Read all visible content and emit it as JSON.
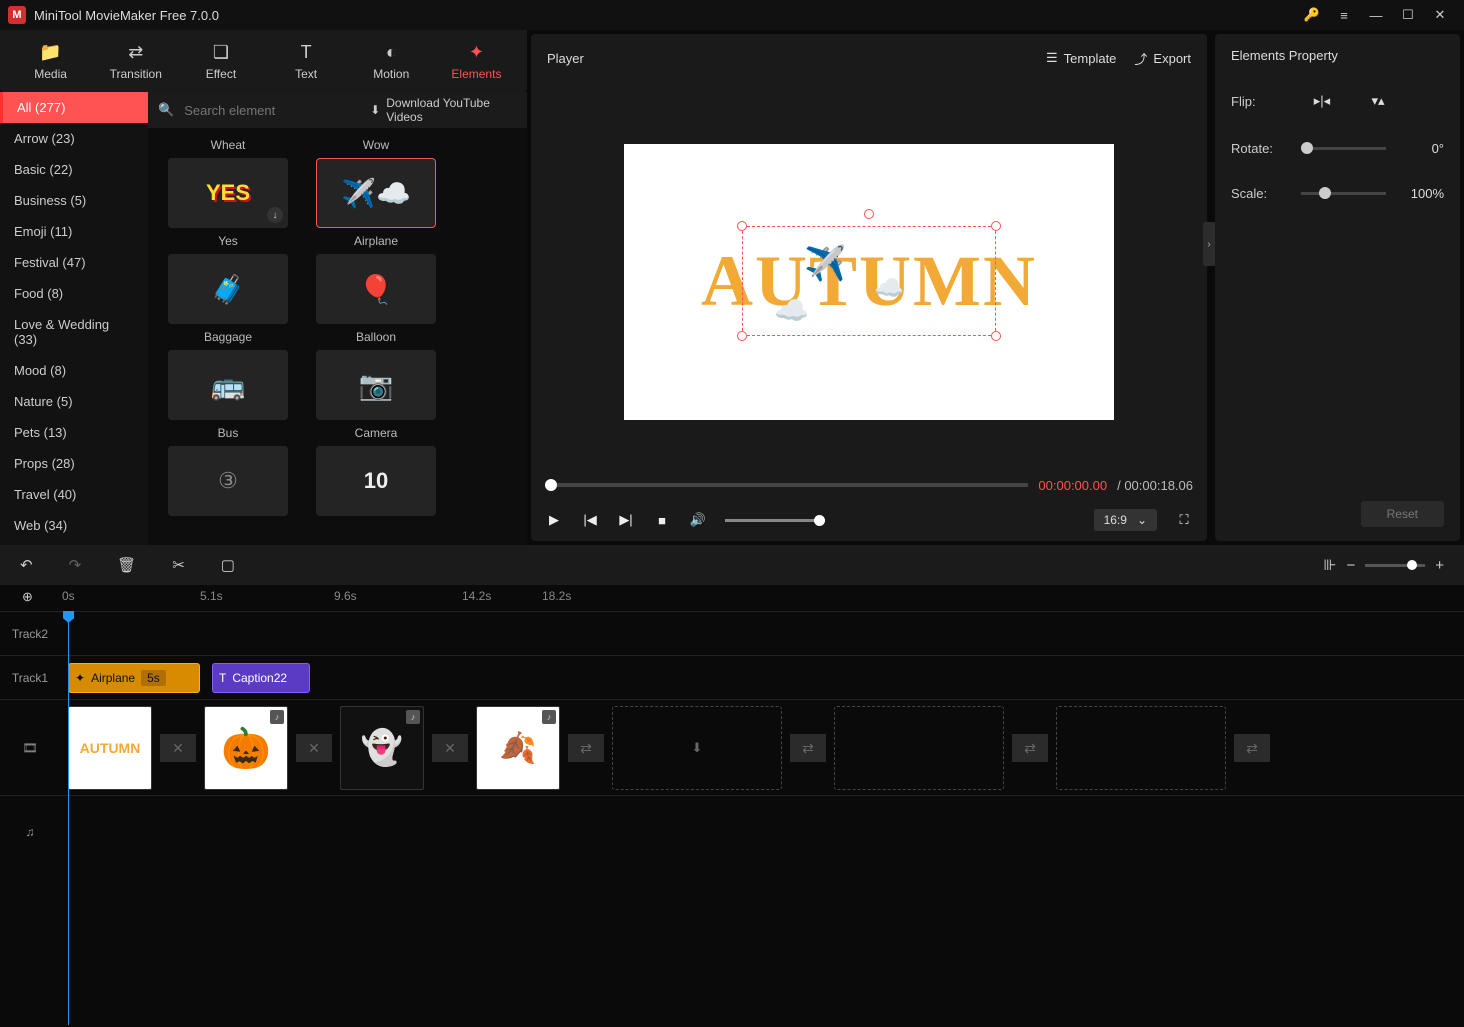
{
  "app": {
    "title": "MiniTool MovieMaker Free 7.0.0"
  },
  "toolbar": {
    "media": "Media",
    "transition": "Transition",
    "effect": "Effect",
    "text": "Text",
    "motion": "Motion",
    "elements": "Elements"
  },
  "categories": [
    "All (277)",
    "Arrow (23)",
    "Basic (22)",
    "Business (5)",
    "Emoji (11)",
    "Festival (47)",
    "Food (8)",
    "Love & Wedding (33)",
    "Mood (8)",
    "Nature (5)",
    "Pets (13)",
    "Props (28)",
    "Travel (40)",
    "Web (34)"
  ],
  "search": {
    "placeholder": "Search element",
    "download": "Download YouTube Videos"
  },
  "elements": {
    "row0": [
      "Wheat",
      "Wow"
    ],
    "row1": [
      "Yes",
      "Airplane"
    ],
    "row2": [
      "Baggage",
      "Balloon"
    ],
    "row3": [
      "Bus",
      "Camera"
    ]
  },
  "player": {
    "title": "Player",
    "template": "Template",
    "export": "Export",
    "current": "00:00:00.00",
    "total": "/ 00:00:18.06",
    "ratio": "16:9",
    "canvas_text": "AUTUMN"
  },
  "props": {
    "title": "Elements Property",
    "flip": "Flip:",
    "rotate": "Rotate:",
    "rotate_val": "0°",
    "scale": "Scale:",
    "scale_val": "100%",
    "reset": "Reset"
  },
  "timeline": {
    "ticks": [
      "0s",
      "5.1s",
      "9.6s",
      "14.2s",
      "18.2s"
    ],
    "track2": "Track2",
    "track1": "Track1",
    "clip_el_name": "Airplane",
    "clip_el_dur": "5s",
    "clip_txt_name": "Caption22"
  }
}
